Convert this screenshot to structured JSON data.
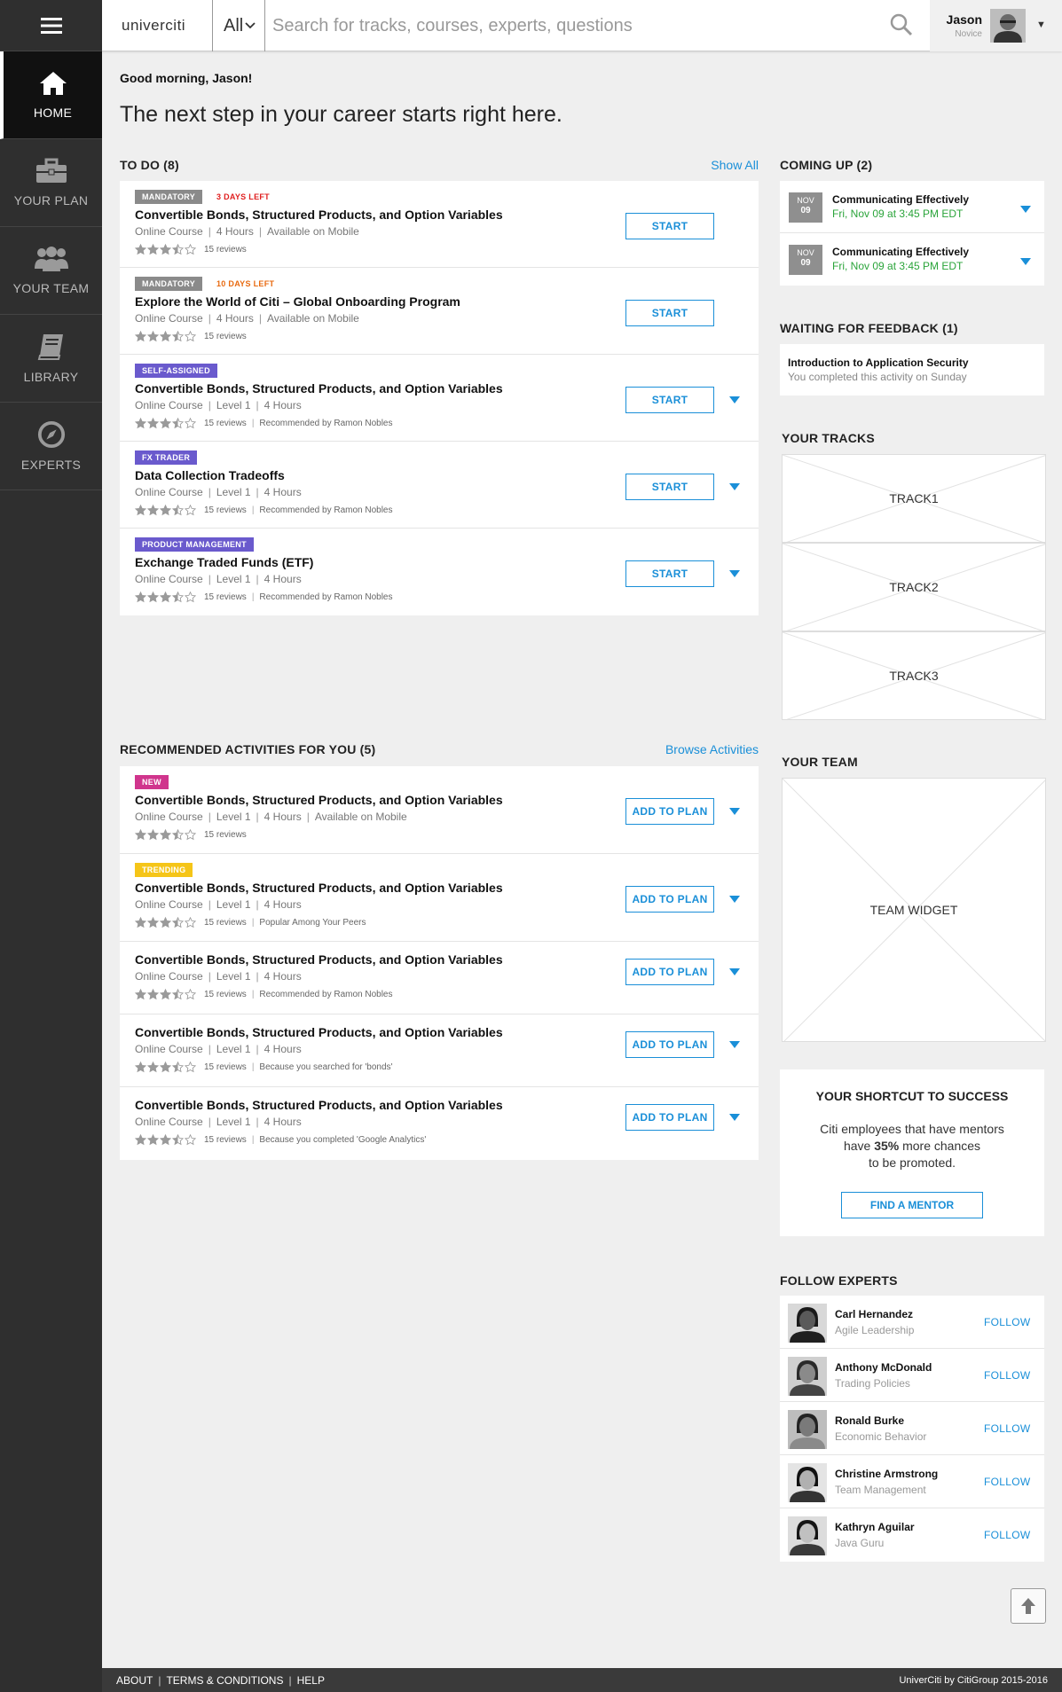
{
  "sidebar": {
    "menu_icon": "hamburger-icon",
    "items": [
      {
        "label": "HOME",
        "icon": "home-icon",
        "active": true
      },
      {
        "label": "YOUR PLAN",
        "icon": "briefcase-icon"
      },
      {
        "label": "YOUR TEAM",
        "icon": "team-icon"
      },
      {
        "label": "LIBRARY",
        "icon": "book-icon"
      },
      {
        "label": "EXPERTS",
        "icon": "compass-icon"
      }
    ]
  },
  "header": {
    "logo": "univerciti",
    "scope": "All",
    "search_placeholder": "Search for tracks, courses, experts, questions",
    "user_name": "Jason",
    "user_level": "Novice"
  },
  "greeting": "Good morning, Jason!",
  "headline": "The next step in your career starts right here.",
  "todo": {
    "title": "TO DO (8)",
    "link": "Show All",
    "items": [
      {
        "badge": "MANDATORY",
        "badge_color": "#8a8a8a",
        "deadline": "3 DAYS LEFT",
        "deadline_color": "#e02020",
        "title": "Convertible Bonds, Structured Products, and Option Variables",
        "meta": [
          "Online Course",
          "4 Hours",
          "Available on Mobile"
        ],
        "rating": 3.5,
        "reviews": "15 reviews",
        "recommendation": "",
        "action": "START",
        "expandable": false
      },
      {
        "badge": "MANDATORY",
        "badge_color": "#8a8a8a",
        "deadline": "10 DAYS LEFT",
        "deadline_color": "#e86a10",
        "title": "Explore the World of Citi – Global Onboarding Program",
        "meta": [
          "Online Course",
          "4 Hours",
          "Available on Mobile"
        ],
        "rating": 3.5,
        "reviews": "15 reviews",
        "recommendation": "",
        "action": "START",
        "expandable": false
      },
      {
        "badge": "SELF-ASSIGNED",
        "badge_color": "#6a5acd",
        "deadline": "",
        "title": "Convertible Bonds, Structured Products, and Option Variables",
        "meta": [
          "Online Course",
          "Level 1",
          "4 Hours"
        ],
        "rating": 3.5,
        "reviews": "15 reviews",
        "recommendation": "Recommended by Ramon Nobles",
        "action": "START",
        "expandable": true
      },
      {
        "badge": "FX TRADER",
        "badge_color": "#6a5acd",
        "deadline": "",
        "title": "Data Collection Tradeoffs",
        "meta": [
          "Online Course",
          "Level 1",
          "4 Hours"
        ],
        "rating": 3.5,
        "reviews": "15 reviews",
        "recommendation": "Recommended by Ramon Nobles",
        "action": "START",
        "expandable": true
      },
      {
        "badge": "PRODUCT MANAGEMENT",
        "badge_color": "#6a5acd",
        "deadline": "",
        "title": "Exchange Traded Funds (ETF)",
        "meta": [
          "Online Course",
          "Level 1",
          "4 Hours"
        ],
        "rating": 3.5,
        "reviews": "15 reviews",
        "recommendation": "Recommended by Ramon Nobles",
        "action": "START",
        "expandable": true
      }
    ]
  },
  "recommended": {
    "title": "RECOMMENDED ACTIVITIES FOR YOU (5)",
    "link": "Browse Activities",
    "items": [
      {
        "badge": "NEW",
        "badge_color": "#d0358d",
        "title": "Convertible Bonds, Structured Products, and Option Variables",
        "meta": [
          "Online Course",
          "Level 1",
          "4 Hours",
          "Available on Mobile"
        ],
        "rating": 3.5,
        "reviews": "15 reviews",
        "recommendation": "",
        "action": "ADD TO PLAN"
      },
      {
        "badge": "TRENDING",
        "badge_color": "#f5c518",
        "title": "Convertible Bonds, Structured Products, and Option Variables",
        "meta": [
          "Online Course",
          "Level 1",
          "4 Hours"
        ],
        "rating": 3.5,
        "reviews": "15 reviews",
        "recommendation": "Popular Among Your Peers",
        "action": "ADD TO PLAN"
      },
      {
        "badge": "",
        "title": "Convertible Bonds, Structured Products, and Option Variables",
        "meta": [
          "Online Course",
          "Level 1",
          "4 Hours"
        ],
        "rating": 3.5,
        "reviews": "15 reviews",
        "recommendation": "Recommended by Ramon Nobles",
        "action": "ADD TO PLAN"
      },
      {
        "badge": "",
        "title": "Convertible Bonds, Structured Products, and Option Variables",
        "meta": [
          "Online Course",
          "Level 1",
          "4 Hours"
        ],
        "rating": 3.5,
        "reviews": "15 reviews",
        "recommendation": "Because you searched for 'bonds'",
        "action": "ADD TO PLAN"
      },
      {
        "badge": "",
        "title": "Convertible Bonds, Structured Products, and Option Variables",
        "meta": [
          "Online Course",
          "Level 1",
          "4 Hours"
        ],
        "rating": 3.5,
        "reviews": "15 reviews",
        "recommendation": "Because you completed 'Google Analytics'",
        "action": "ADD TO PLAN"
      }
    ]
  },
  "coming_up": {
    "title": "COMING UP (2)",
    "events": [
      {
        "month": "NOV",
        "day": "09",
        "title": "Communicating Effectively",
        "time": "Fri, Nov 09 at 3:45 PM EDT"
      },
      {
        "month": "NOV",
        "day": "09",
        "title": "Communicating Effectively",
        "time": "Fri, Nov 09 at 3:45 PM EDT"
      }
    ]
  },
  "feedback": {
    "title": "WAITING FOR FEEDBACK (1)",
    "item_title": "Introduction to Application Security",
    "item_sub": "You completed this activity on Sunday"
  },
  "tracks": {
    "title": "YOUR TRACKS",
    "items": [
      "TRACK1",
      "TRACK2",
      "TRACK3"
    ]
  },
  "team": {
    "title": "YOUR TEAM",
    "widget": "TEAM WIDGET"
  },
  "shortcut": {
    "title": "YOUR SHORTCUT TO SUCCESS",
    "line1": "Citi employees that have mentors",
    "line2_pre": "have ",
    "line2_bold": "35%",
    "line2_post": " more chances",
    "line3": "to be promoted.",
    "button": "FIND A MENTOR"
  },
  "experts": {
    "title": "FOLLOW EXPERTS",
    "follow_label": "FOLLOW",
    "items": [
      {
        "name": "Carl Hernandez",
        "topic": "Agile Leadership"
      },
      {
        "name": "Anthony McDonald",
        "topic": "Trading Policies"
      },
      {
        "name": "Ronald Burke",
        "topic": "Economic Behavior"
      },
      {
        "name": "Christine Armstrong",
        "topic": "Team Management"
      },
      {
        "name": "Kathryn Aguilar",
        "topic": "Java Guru"
      }
    ]
  },
  "footer": {
    "links": [
      "ABOUT",
      "TERMS & CONDITIONS",
      "HELP"
    ],
    "copyright": "UniverCiti by CitiGroup 2015-2016"
  },
  "colors": {
    "accent": "#1a8fd8",
    "sidebar": "#2f2f2f",
    "success": "#2aa43a"
  }
}
